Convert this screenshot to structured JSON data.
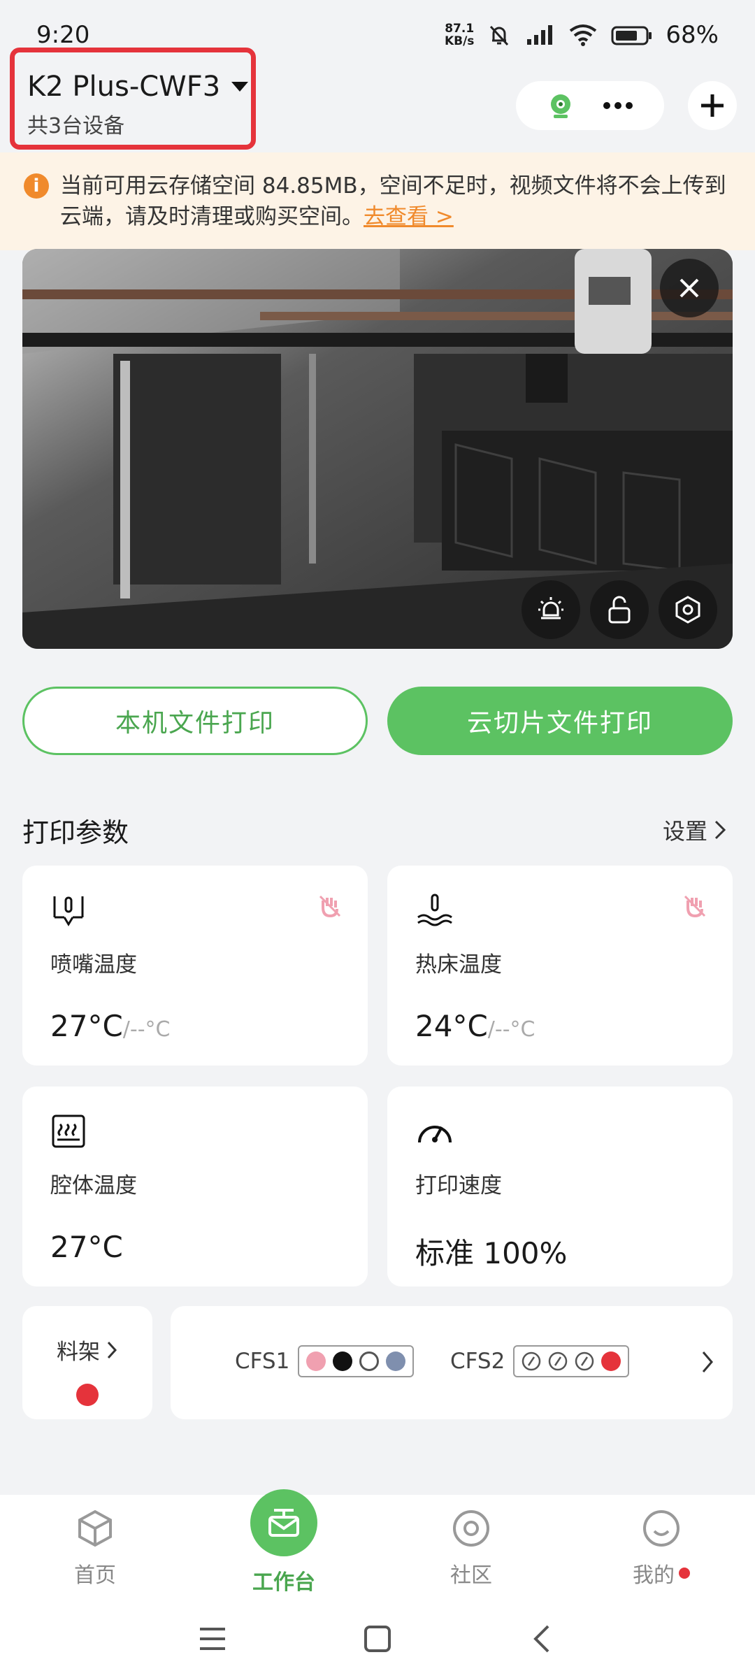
{
  "status": {
    "time": "9:20",
    "net_top": "87.1",
    "net_bottom": "KB/s",
    "battery": "68%"
  },
  "header": {
    "device_name": "K2 Plus-CWF3",
    "device_count": "共3台设备"
  },
  "notice": {
    "text": "当前可用云存储空间 84.85MB，空间不足时，视频文件将不会上传到云端，请及时清理或购买空间。",
    "link": "去查看 >"
  },
  "actions": {
    "local_print": "本机文件打印",
    "cloud_print": "云切片文件打印"
  },
  "print_params": {
    "title": "打印参数",
    "settings": "设置",
    "nozzle": {
      "label": "喷嘴温度",
      "value": "27°C",
      "target": "/--°C"
    },
    "bed": {
      "label": "热床温度",
      "value": "24°C",
      "target": "/--°C"
    },
    "chamber": {
      "label": "腔体温度",
      "value": "27°C"
    },
    "speed": {
      "label": "打印速度",
      "value": "标准 100%"
    }
  },
  "rack": {
    "label": "料架",
    "color": "#e5333b"
  },
  "cfs": [
    {
      "name": "CFS1",
      "slots": [
        "#f0a0b0",
        "#111111",
        "#ffffff",
        "#7f8fae"
      ]
    },
    {
      "name": "CFS2",
      "slots": [
        "empty",
        "empty",
        "empty",
        "#e5333b"
      ]
    }
  ],
  "tabs": {
    "home": "首页",
    "workbench": "工作台",
    "community": "社区",
    "mine": "我的"
  },
  "colors": {
    "accent": "#5cc262",
    "warning": "#f08a2c",
    "highlight": "#e5333b"
  }
}
